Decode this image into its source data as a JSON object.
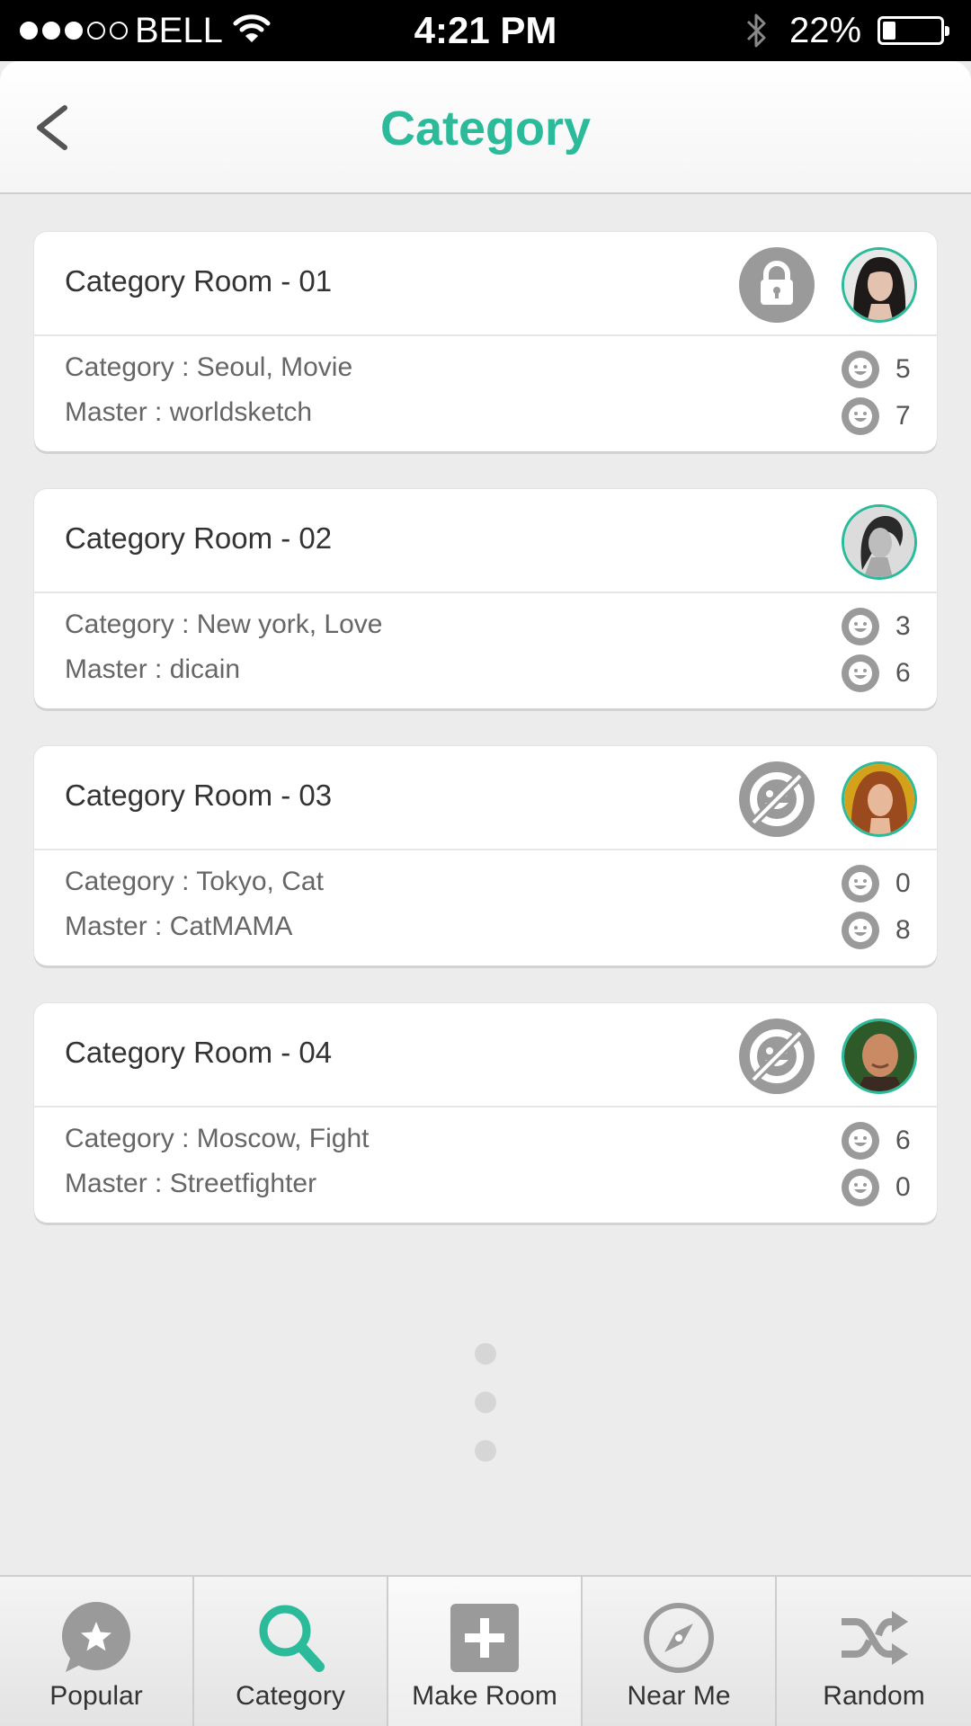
{
  "status_bar": {
    "carrier": "BELL",
    "time": "4:21 PM",
    "battery_percent": "22%",
    "battery_level": 0.22,
    "signal_bars_filled": 3,
    "signal_bars_total": 5
  },
  "nav": {
    "title": "Category",
    "back_icon": "chevron-left-icon"
  },
  "colors": {
    "accent": "#2bbb9a",
    "icon_gray": "#9a9a9a",
    "background": "#ececec"
  },
  "rooms": [
    {
      "title": "Category Room - 01",
      "status_icon": "lock-icon",
      "category_text": "Category : Seoul, Movie",
      "master_text": "Master : worldsketch",
      "count_1": "5",
      "count_2": "7"
    },
    {
      "title": "Category Room - 02",
      "status_icon": "",
      "category_text": "Category : New york, Love",
      "master_text": "Master : dicain",
      "count_1": "3",
      "count_2": "6"
    },
    {
      "title": "Category Room - 03",
      "status_icon": "no-members-icon",
      "category_text": "Category : Tokyo, Cat",
      "master_text": "Master : CatMAMA",
      "count_1": "0",
      "count_2": "8"
    },
    {
      "title": "Category Room - 04",
      "status_icon": "no-members-icon",
      "category_text": "Category : Moscow, Fight",
      "master_text": "Master : Streetfighter",
      "count_1": "6",
      "count_2": "0"
    }
  ],
  "tabs": [
    {
      "label": "Popular",
      "icon": "star-bubble-icon"
    },
    {
      "label": "Category",
      "icon": "search-icon",
      "active": true
    },
    {
      "label": "Make Room",
      "icon": "plus-icon"
    },
    {
      "label": "Near Me",
      "icon": "compass-icon"
    },
    {
      "label": "Random",
      "icon": "shuffle-icon"
    }
  ]
}
